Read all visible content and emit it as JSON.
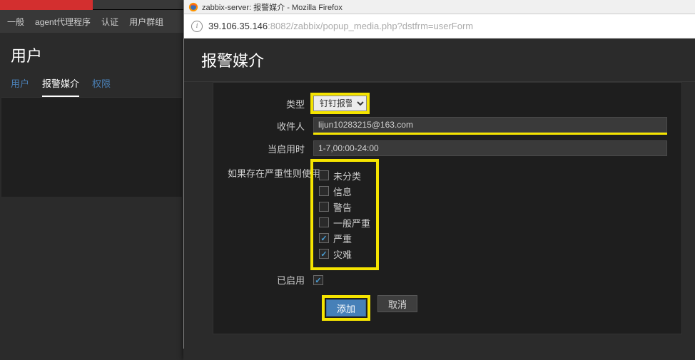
{
  "parent": {
    "top_nav": [
      "一般",
      "agent代理程序",
      "认证",
      "用户群组"
    ],
    "page_title": "用户",
    "tabs": [
      {
        "label": "用户",
        "active": false
      },
      {
        "label": "报警媒介",
        "active": true
      },
      {
        "label": "权限",
        "active": false
      }
    ]
  },
  "popup": {
    "window_title": "zabbix-server: 报警媒介 - Mozilla Firefox",
    "url_host": "39.106.35.146",
    "url_port": ":8082",
    "url_path": "/zabbix/popup_media.php?dstfrm=userForm",
    "heading": "报警媒介",
    "labels": {
      "type": "类型",
      "send_to": "收件人",
      "when_active": "当启用时",
      "use_if_severity": "如果存在严重性则使用",
      "enabled": "已启用"
    },
    "values": {
      "type": "钉钉报警",
      "send_to": "lijun10283215@163.com",
      "when_active": "1-7,00:00-24:00",
      "enabled": true
    },
    "severities": [
      {
        "label": "未分类",
        "checked": false
      },
      {
        "label": "信息",
        "checked": false
      },
      {
        "label": "警告",
        "checked": false
      },
      {
        "label": "一般严重",
        "checked": false
      },
      {
        "label": "严重",
        "checked": true
      },
      {
        "label": "灾难",
        "checked": true
      }
    ],
    "buttons": {
      "add": "添加",
      "cancel": "取消"
    }
  }
}
